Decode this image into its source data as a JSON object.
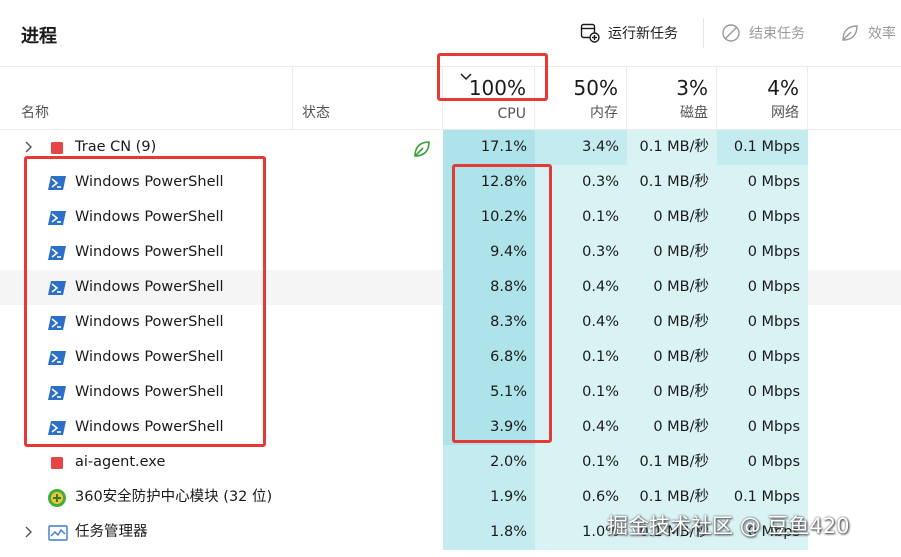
{
  "toolbar": {
    "title": "进程",
    "run_task": "运行新任务",
    "end_task": "结束任务",
    "efficiency": "效率"
  },
  "columns": {
    "name": "名称",
    "status": "状态",
    "cpu": {
      "pct": "100%",
      "label": "CPU"
    },
    "mem": {
      "pct": "50%",
      "label": "内存"
    },
    "disk": {
      "pct": "3%",
      "label": "磁盘"
    },
    "net": {
      "pct": "4%",
      "label": "网络"
    }
  },
  "colors": {
    "cpu_bg_hi": "#aee3e9",
    "cpu_bg": "#c4ecf0",
    "light_bg": "#d9f3f5",
    "highlight": "#e53935"
  },
  "rows": [
    {
      "name": "Trae CN (9)",
      "icon": "red-square-icon",
      "expandable": true,
      "status": "eco-leaf-icon",
      "cpu": "17.1%",
      "mem": "3.4%",
      "disk": "0.1 MB/秒",
      "net": "0.1 Mbps"
    },
    {
      "name": "Windows PowerShell",
      "icon": "powershell-icon",
      "cpu": "12.8%",
      "mem": "0.3%",
      "disk": "0.1 MB/秒",
      "net": "0 Mbps"
    },
    {
      "name": "Windows PowerShell",
      "icon": "powershell-icon",
      "cpu": "10.2%",
      "mem": "0.1%",
      "disk": "0 MB/秒",
      "net": "0 Mbps"
    },
    {
      "name": "Windows PowerShell",
      "icon": "powershell-icon",
      "cpu": "9.4%",
      "mem": "0.3%",
      "disk": "0 MB/秒",
      "net": "0 Mbps"
    },
    {
      "name": "Windows PowerShell",
      "icon": "powershell-icon",
      "cpu": "8.8%",
      "mem": "0.4%",
      "disk": "0 MB/秒",
      "net": "0 Mbps"
    },
    {
      "name": "Windows PowerShell",
      "icon": "powershell-icon",
      "cpu": "8.3%",
      "mem": "0.4%",
      "disk": "0 MB/秒",
      "net": "0 Mbps"
    },
    {
      "name": "Windows PowerShell",
      "icon": "powershell-icon",
      "cpu": "6.8%",
      "mem": "0.1%",
      "disk": "0 MB/秒",
      "net": "0 Mbps"
    },
    {
      "name": "Windows PowerShell",
      "icon": "powershell-icon",
      "cpu": "5.1%",
      "mem": "0.1%",
      "disk": "0 MB/秒",
      "net": "0 Mbps"
    },
    {
      "name": "Windows PowerShell",
      "icon": "powershell-icon",
      "cpu": "3.9%",
      "mem": "0.4%",
      "disk": "0 MB/秒",
      "net": "0 Mbps"
    },
    {
      "name": "ai-agent.exe",
      "icon": "red-square-icon",
      "cpu": "2.0%",
      "mem": "0.1%",
      "disk": "0.1 MB/秒",
      "net": "0 Mbps"
    },
    {
      "name": "360安全防护中心模块 (32 位)",
      "icon": "360-shield-icon",
      "cpu": "1.9%",
      "mem": "0.6%",
      "disk": "0.1 MB/秒",
      "net": "0.1 Mbps"
    },
    {
      "name": "任务管理器",
      "icon": "task-manager-icon",
      "expandable": true,
      "cpu": "1.8%",
      "mem": "1.0%",
      "disk": "0.1 MB/秒",
      "net": "0 Mbps"
    }
  ],
  "watermark": "掘金技术社区 @ 豆鱼420"
}
